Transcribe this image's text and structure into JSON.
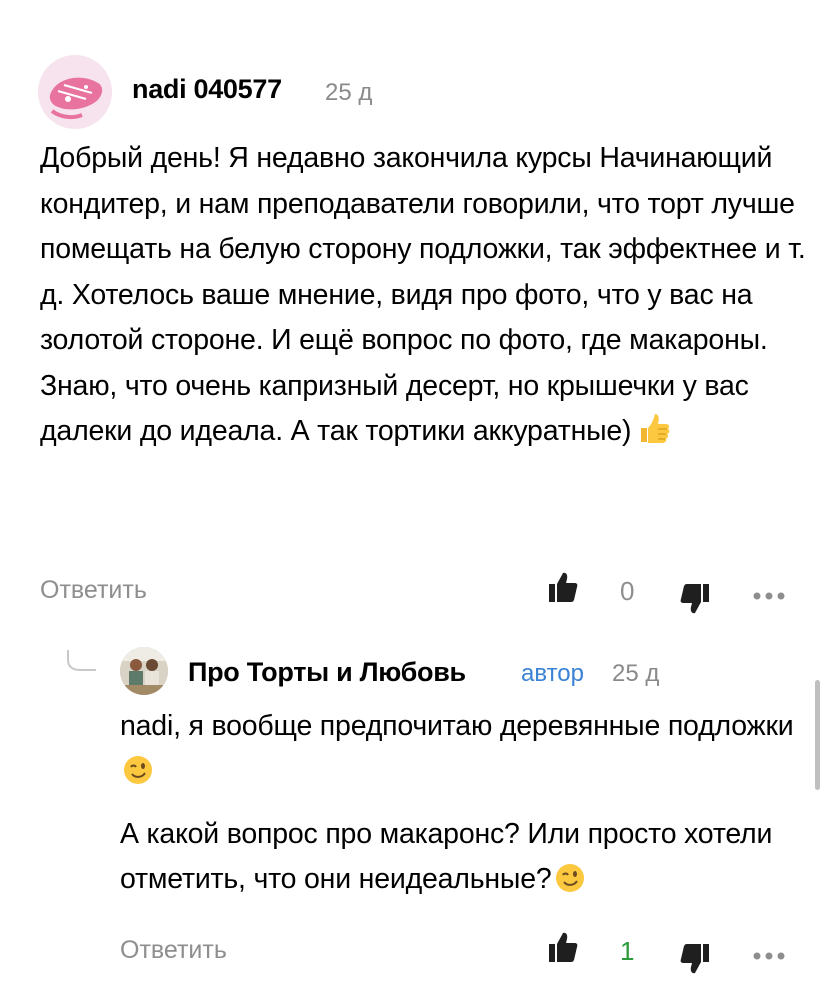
{
  "comment": {
    "author": "nadi 040577",
    "date": "25 д",
    "avatar_icon": "pink-fish-avatar-icon",
    "body": [
      "Добрый день! Я недавно закончила курсы Начинающий кондитер, и нам преподаватели говорили, что торт лучше помещать на белую сторону подложки, так эффектнее и т. д. Хотелось ваше мнение, видя про фото, что у вас на золотой стороне. И ещё вопрос по фото, где макароны. Знаю, что очень капризный десерт, но крышечки у вас далеки до идеала. А так тортики аккуратные)"
    ],
    "body_emoji": "thumbs-up-emoji",
    "reply_label": "Ответить",
    "like_count": "0",
    "like_count_color": "#8e8e8e"
  },
  "reply": {
    "author": "Про Торты и Любовь",
    "badge": "автор",
    "date": "25 д",
    "avatar_icon": "couple-photo-avatar",
    "paragraphs": [
      "nadi, я вообще предпочитаю деревянные подложки",
      "А какой вопрос про макаронс? Или просто хотели отметить, что они неидеальные?"
    ],
    "paragraph_emoji": "winking-face-emoji",
    "reply_label": "Ответить",
    "like_count": "1",
    "like_count_color": "#2a9a3a",
    "accent_color": "#3a82d6"
  }
}
